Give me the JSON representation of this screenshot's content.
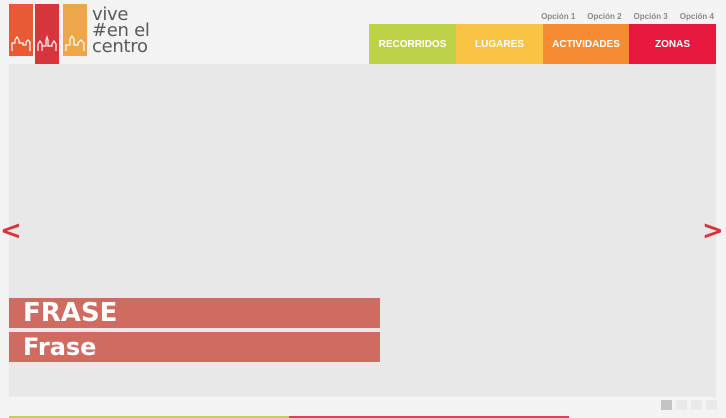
{
  "logo": {
    "line1": "vive",
    "line2": "#en el",
    "line3": "centro"
  },
  "top_menu": [
    "Opción 1",
    "Opción 2",
    "Opción 3",
    "Opción 4"
  ],
  "main_nav": [
    {
      "label": "RECORRIDOS",
      "color": "#bfd149"
    },
    {
      "label": "LUGARES",
      "color": "#f9c343"
    },
    {
      "label": "ACTIVIDADES",
      "color": "#f58c33"
    },
    {
      "label": "ZONAS",
      "color": "#e8173e"
    }
  ],
  "slider": {
    "prev_icon": "chevron-left-icon",
    "next_icon": "chevron-right-icon",
    "prev_glyph": "<",
    "next_glyph": ">",
    "caption_title": "FRASE",
    "caption_sub": "Frase",
    "slides_count": 4,
    "active_slide": 1
  },
  "colors": {
    "tile1": "#e85a34",
    "tile2": "#d6363b",
    "tile3": "#eea64a",
    "caption_bg": "#cf6b60"
  }
}
